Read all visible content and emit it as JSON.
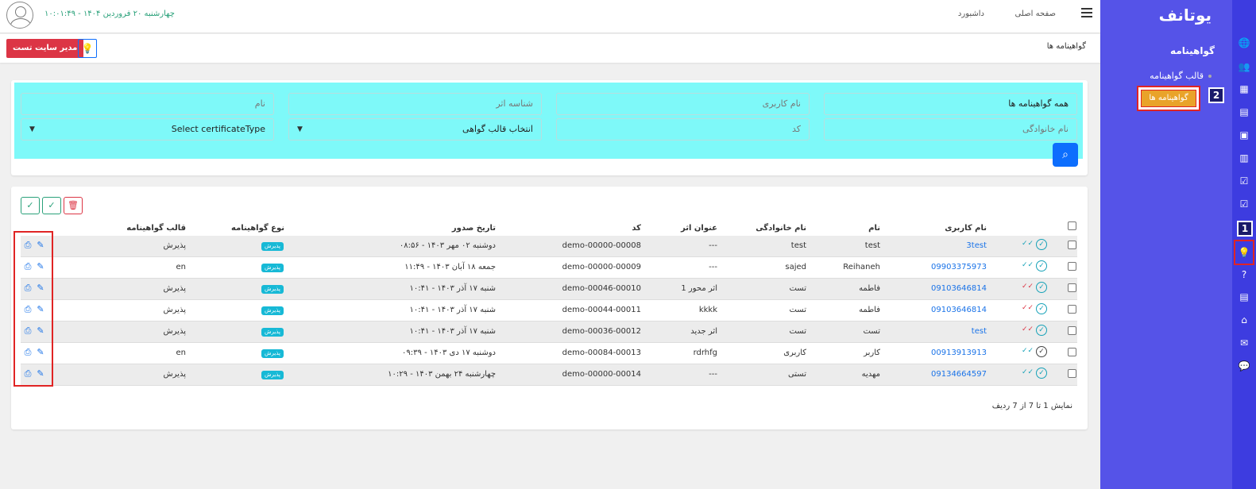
{
  "app": {
    "logo": "یوتانف"
  },
  "sidebar": {
    "title": "گواهینامه",
    "items": [
      {
        "label": "قالب گواهینامه"
      },
      {
        "label": "گواهینامه ها"
      }
    ],
    "badges": [
      "1",
      "2"
    ]
  },
  "iconbar": {
    "icons": [
      "globe-icon",
      "users-icon",
      "building-icon",
      "card-icon",
      "person-card-icon",
      "book-icon",
      "checkbox-icon",
      "certificate-icon",
      "help-icon",
      "list-icon",
      "store-icon",
      "mail-icon",
      "chat-icon"
    ]
  },
  "topbar": {
    "nav": [
      "صفحه اصلی",
      "داشبورد"
    ],
    "datetime": "چهارشنبه ۲۰ فروردین ۱۴۰۴ - ۱۰:۰۱:۴۹"
  },
  "crumbbar": {
    "title": "گواهینامه ها",
    "user_button": "مدیر سایت تست"
  },
  "filters": {
    "certificate_select": "همه گواهینامه ها",
    "username": "نام کاربری",
    "work_id": "شناسه اثر",
    "name": "نام",
    "family": "نام خانوادگی",
    "code": "کد",
    "template_select": "انتخاب قالب گواهی",
    "type_select": "Select certificateType"
  },
  "table": {
    "headers": {
      "username": "نام کاربری",
      "name": "نام",
      "family": "نام خانوادگی",
      "work_title": "عنوان اثر",
      "code": "کد",
      "issue_date": "تاریخ صدور",
      "type": "نوع گواهینامه",
      "template": "قالب گواهینامه"
    },
    "rows": [
      {
        "username": "3test",
        "name": "test",
        "family": "test",
        "work": "---",
        "code": "demo-00000-00008",
        "date": "دوشنبه ۰۲ مهر ۱۴۰۳ - ۰۸:۵۶",
        "type": "پذیرش",
        "template": "پذیرش"
      },
      {
        "username": "09903375973",
        "name": "Reihaneh",
        "family": "sajed",
        "work": "---",
        "code": "demo-00000-00009",
        "date": "جمعه ۱۸ آبان ۱۴۰۳ - ۱۱:۴۹",
        "type": "پذیرش",
        "template": "en"
      },
      {
        "username": "09103646814",
        "name": "فاطمه",
        "family": "تست",
        "work": "اثر محور 1",
        "code": "demo-00046-00010",
        "date": "شنبه ۱۷ آذر ۱۴۰۳ - ۱۰:۴۱",
        "type": "پذیرش",
        "template": "پذیرش"
      },
      {
        "username": "09103646814",
        "name": "فاطمه",
        "family": "تست",
        "work": "kkkk",
        "code": "demo-00044-00011",
        "date": "شنبه ۱۷ آذر ۱۴۰۳ - ۱۰:۴۱",
        "type": "پذیرش",
        "template": "پذیرش"
      },
      {
        "username": "test",
        "name": "تست",
        "family": "تست",
        "work": "اثر جدید",
        "code": "demo-00036-00012",
        "date": "شنبه ۱۷ آذر ۱۴۰۳ - ۱۰:۴۱",
        "type": "پذیرش",
        "template": "پذیرش"
      },
      {
        "username": "00913913913",
        "name": "کاربر",
        "family": "کاربری",
        "work": "rdrhfg",
        "code": "demo-00084-00013",
        "date": "دوشنبه ۱۷ دی ۱۴۰۳ - ۰۹:۳۹",
        "type": "پذیرش",
        "template": "en"
      },
      {
        "username": "09134664597",
        "name": "مهدیه",
        "family": "تستی",
        "work": "---",
        "code": "demo-00000-00014",
        "date": "چهارشنبه ۲۴ بهمن ۱۴۰۳ - ۱۰:۲۹",
        "type": "پذیرش",
        "template": "پذیرش"
      }
    ]
  },
  "footer": {
    "summary": "نمایش 1 تا 7 از 7 ردیف"
  },
  "colors": {
    "sidebar": "#5553e8",
    "iconbar": "#3d3ce0",
    "highlight": "#7ef9f9",
    "primary": "#0d6efd",
    "danger": "#dc3545"
  }
}
